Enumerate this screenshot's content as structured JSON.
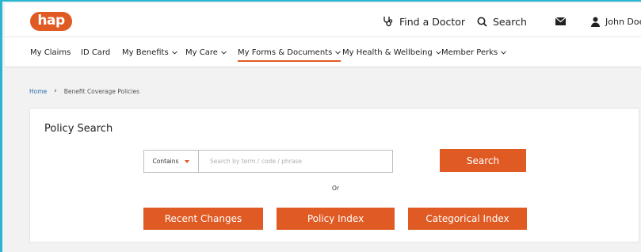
{
  "header": {
    "logo_text": "hap",
    "find_doctor_label": "Find a Doctor",
    "search_label": "Search",
    "user_name": "John Doe"
  },
  "nav": {
    "items": [
      {
        "label": "My Claims"
      },
      {
        "label": "ID Card"
      },
      {
        "label": "My Benefits"
      },
      {
        "label": "My Care"
      },
      {
        "label": "My Forms & Documents"
      },
      {
        "label": "My Health & Wellbeing"
      },
      {
        "label": "Member Perks"
      }
    ],
    "active": "My Forms & Documents"
  },
  "breadcrumb": {
    "home": "Home",
    "current": "Benefit Coverage Policies"
  },
  "policy_search": {
    "title": "Policy Search",
    "match_mode": "Contains",
    "input_placeholder": "Search by term / code / phrase",
    "search_button": "Search",
    "or_text": "Or",
    "recent_changes_button": "Recent Changes",
    "policy_index_button": "Policy Index",
    "categorical_index_button": "Categorical Index"
  },
  "colors": {
    "accent": "#e05a24",
    "frame": "#27b5cf",
    "link": "#2a6ea8"
  }
}
